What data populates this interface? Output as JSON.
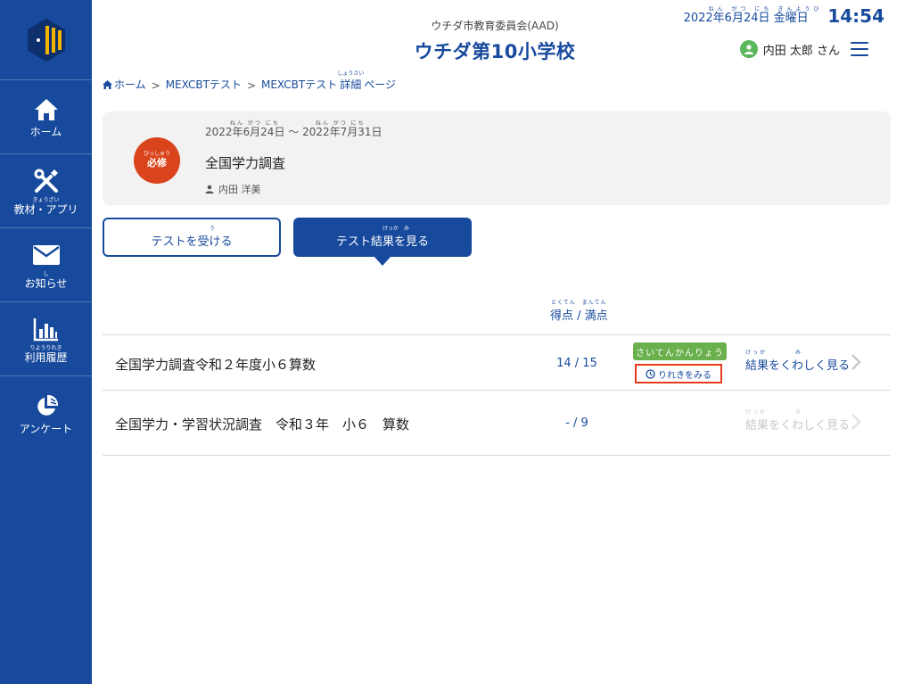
{
  "colors": {
    "primary": "#174a9c",
    "required": "#d9441c",
    "green": "#6ab04c",
    "highlight": "#e53b1c"
  },
  "sidebar": {
    "items": [
      {
        "label": "ホーム",
        "ruby": "",
        "icon": "home-icon"
      },
      {
        "label": "教材・アプリ",
        "ruby": "きょうざい",
        "icon": "tools-icon"
      },
      {
        "label": "お知らせ",
        "ruby": "し",
        "icon": "mail-icon"
      },
      {
        "label": "利用履歴",
        "ruby": "りようりれき",
        "icon": "bar-chart-icon"
      },
      {
        "label": "アンケート",
        "ruby": "",
        "icon": "pie-chart-icon"
      }
    ]
  },
  "header": {
    "subtitle": "ウチダ市教育委員会(AAD)",
    "title": "ウチダ第10小学校",
    "date_ruby": "ねん がつ にち きんようび",
    "date": "2022年6月24日 金曜日",
    "time": "14:54",
    "user_name": "内田 太郎 さん"
  },
  "breadcrumb": {
    "home": "ホーム",
    "sep": ">",
    "level1": "MEXCBTテスト",
    "level2_prefix": "MEXCBTテスト",
    "level2_ruby": "しょうさい",
    "level2_main": "詳細",
    "level2_suffix": "ページ"
  },
  "card": {
    "badge_ruby": "ひっしゅう",
    "badge_label": "必修",
    "period_ruby": "ねん がつ にち　　　　　ねん がつ にち",
    "period": "2022年6月24日 〜 2022年7月31日",
    "title": "全国学力調査",
    "person": "内田 洋美"
  },
  "tabs": {
    "take_ruby": "う",
    "take_label": "テストを受ける",
    "result_ruby": "けっか　み",
    "result_label": "テスト結果を見る"
  },
  "table": {
    "score_header_ruby": "とくてん　まんてん",
    "score_header": "得点 / 満点",
    "rows": [
      {
        "title": "全国学力調査令和２年度小６算数",
        "score": "14 / 15",
        "tag": "さいてんかんりょう",
        "history_label": "りれきをみる",
        "detail_ruby": "けっか　　　　み",
        "detail_label": "結果をくわしく見る"
      },
      {
        "title": "全国学力・学習状況調査　令和３年　小６　算数",
        "score": "- / 9",
        "detail_ruby": "けっか　　　　み",
        "detail_label": "結果をくわしく見る"
      }
    ]
  }
}
